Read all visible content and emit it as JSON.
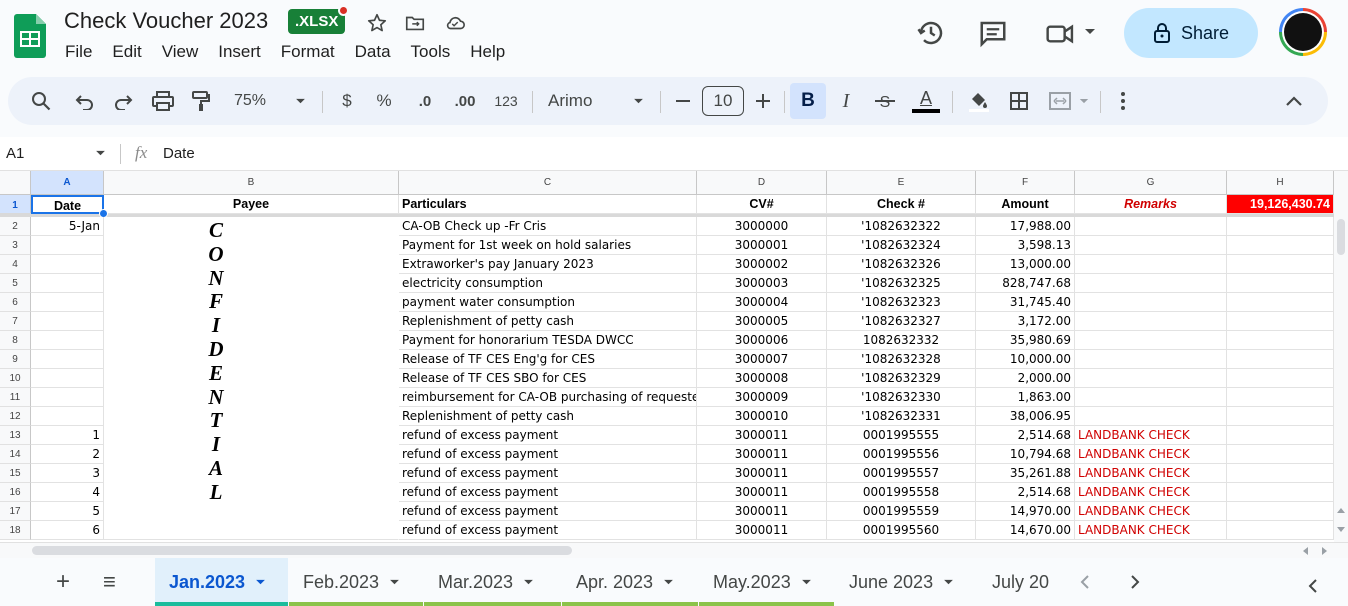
{
  "app": {
    "doc_title": "Check Voucher 2023",
    "file_badge": ".XLSX",
    "menu": [
      "File",
      "Edit",
      "View",
      "Insert",
      "Format",
      "Data",
      "Tools",
      "Help"
    ],
    "share_label": "Share",
    "brand_color": "#188038",
    "accent_color": "#c2e7ff"
  },
  "toolbar": {
    "zoom": "75%",
    "currency": "$",
    "percent": "%",
    "dec_minus": ".0",
    "dec_plus": ".00",
    "number_format": "123",
    "font": "Arimo",
    "font_size": "10",
    "bold": "B",
    "italic": "I",
    "text_color": "A"
  },
  "formula": {
    "cell_ref": "A1",
    "fx": "fx",
    "value": "Date"
  },
  "grid": {
    "columns": [
      "A",
      "B",
      "C",
      "D",
      "E",
      "F",
      "G",
      "H"
    ],
    "rows": [
      "1",
      "2",
      "3",
      "4",
      "5",
      "6",
      "7",
      "8",
      "9",
      "10",
      "11",
      "12",
      "13",
      "14",
      "15",
      "16",
      "17",
      "18"
    ],
    "header": [
      "Date",
      "Payee",
      "Particulars",
      "CV#",
      "Check #",
      "Amount",
      "Remarks",
      "19,126,430.74"
    ],
    "confidential": [
      "C",
      "O",
      "N",
      "F",
      "I",
      "D",
      "E",
      "N",
      "T",
      "I",
      "A",
      "L"
    ],
    "data": [
      [
        "5-Jan",
        "CA-OB Check up -Fr Cris",
        "3000000",
        "'1082632322",
        "17,988.00",
        ""
      ],
      [
        "",
        "Payment for 1st week on hold salaries",
        "3000001",
        "'1082632324",
        "3,598.13",
        ""
      ],
      [
        "",
        "Extraworker's pay January 2023",
        "3000002",
        "'1082632326",
        "13,000.00",
        ""
      ],
      [
        "",
        "electricity consumption",
        "3000003",
        "'1082632325",
        "828,747.68",
        ""
      ],
      [
        "",
        "payment water consumption",
        "3000004",
        "'1082632323",
        "31,745.40",
        ""
      ],
      [
        "",
        " Replenishment of petty cash",
        "3000005",
        "'1082632327",
        "3,172.00",
        ""
      ],
      [
        "",
        " Payment for honorarium TESDA DWCC",
        "3000006",
        "1082632332",
        "35,980.69",
        ""
      ],
      [
        "",
        " Release of TF CES Eng'g for CES",
        "3000007",
        "'1082632328",
        "10,000.00",
        ""
      ],
      [
        "",
        " Release of TF CES SBO for CES",
        "3000008",
        "'1082632329",
        "2,000.00",
        ""
      ],
      [
        "",
        " reimbursement for CA-OB purchasing of requested it",
        "3000009",
        "'1082632330",
        "1,863.00",
        ""
      ],
      [
        "",
        " Replenishment of petty cash",
        "3000010",
        "'1082632331",
        "38,006.95",
        ""
      ],
      [
        "1",
        " refund of excess payment",
        "3000011",
        "0001995555",
        "2,514.68",
        "LANDBANK CHECK"
      ],
      [
        "2",
        " refund of excess payment",
        "3000011",
        "0001995556",
        "10,794.68",
        "LANDBANK CHECK"
      ],
      [
        "3",
        " refund of excess payment",
        "3000011",
        "0001995557",
        "35,261.88",
        "LANDBANK CHECK"
      ],
      [
        "4",
        " refund of excess payment",
        "3000011",
        "0001995558",
        "2,514.68",
        "LANDBANK CHECK"
      ],
      [
        "5",
        " refund of excess payment",
        "3000011",
        "0001995559",
        "14,970.00",
        "LANDBANK CHECK"
      ],
      [
        "6",
        " refund of excess payment",
        "3000011",
        "0001995560",
        "14,670.00",
        "LANDBANK CHECK"
      ]
    ]
  },
  "sheets": {
    "tabs": [
      "Jan.2023",
      "Feb.2023",
      "Mar.2023",
      "Apr. 2023",
      "May.2023",
      "June 2023",
      "July 20"
    ],
    "active": "Jan.2023",
    "add": "+",
    "all": "≡"
  }
}
